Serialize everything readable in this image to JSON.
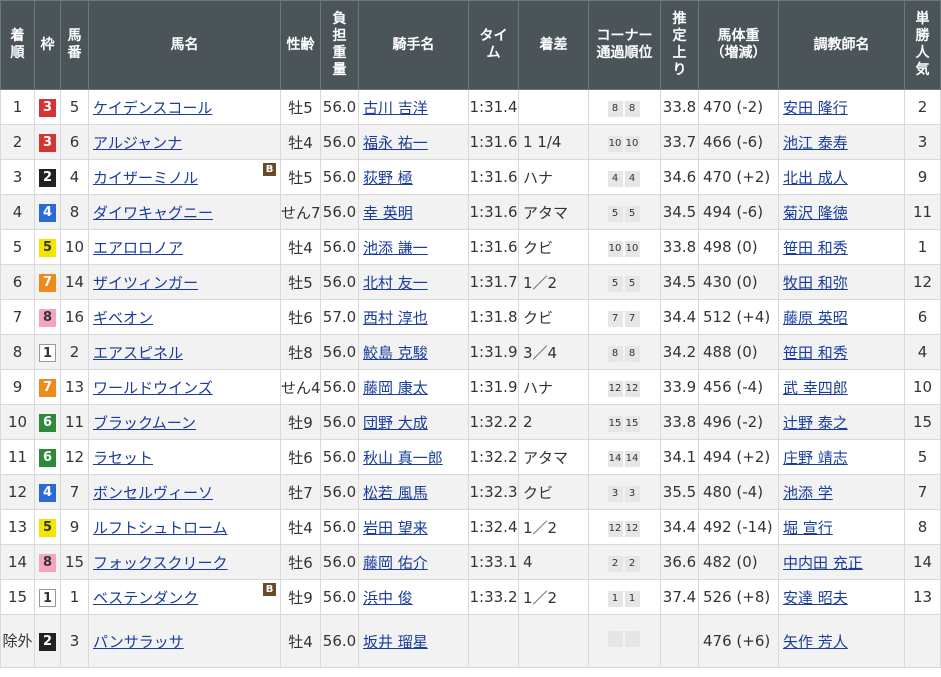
{
  "header": {
    "chakujun": [
      "着",
      "順"
    ],
    "waku": "枠",
    "umaban": [
      "馬",
      "番"
    ],
    "bamei": "馬名",
    "seirei": "性齢",
    "futan": [
      "負",
      "担",
      "重",
      "量"
    ],
    "kishu": "騎手名",
    "time": [
      "タイ",
      "ム"
    ],
    "chakusa": "着差",
    "corner": [
      "コーナー",
      "通過順位"
    ],
    "agari": [
      "推",
      "定",
      "上",
      "り"
    ],
    "bataiju": [
      "馬体重",
      "（増減）"
    ],
    "chokyoshi": "調教師名",
    "ninki": [
      "単",
      "勝",
      "人",
      "気"
    ]
  },
  "rows": [
    {
      "rank": "1",
      "waku": "3",
      "umaban": "5",
      "name": "ケイデンスコール",
      "blinker": "",
      "sexage": "牡5",
      "weight": "56.0",
      "jockey": "古川 吉洋",
      "time": "1:31.4",
      "margin": "",
      "c1": "8",
      "c2": "8",
      "agari": "33.8",
      "bw": "470 (-2)",
      "trainer": "安田 隆行",
      "pop": "2"
    },
    {
      "rank": "2",
      "waku": "3",
      "umaban": "6",
      "name": "アルジャンナ",
      "blinker": "",
      "sexage": "牡4",
      "weight": "56.0",
      "jockey": "福永 祐一",
      "time": "1:31.6",
      "margin": "1 1/4",
      "c1": "10",
      "c2": "10",
      "agari": "33.7",
      "bw": "466 (-6)",
      "trainer": "池江 泰寿",
      "pop": "3"
    },
    {
      "rank": "3",
      "waku": "2",
      "umaban": "4",
      "name": "カイザーミノル",
      "blinker": "B",
      "sexage": "牡5",
      "weight": "56.0",
      "jockey": "荻野 極",
      "time": "1:31.6",
      "margin": "ハナ",
      "c1": "4",
      "c2": "4",
      "agari": "34.6",
      "bw": "470 (+2)",
      "trainer": "北出 成人",
      "pop": "9"
    },
    {
      "rank": "4",
      "waku": "4",
      "umaban": "8",
      "name": "ダイワキャグニー",
      "blinker": "",
      "sexage": "せん7",
      "weight": "56.0",
      "jockey": "幸 英明",
      "time": "1:31.6",
      "margin": "アタマ",
      "c1": "5",
      "c2": "5",
      "agari": "34.5",
      "bw": "494 (-6)",
      "trainer": "菊沢 隆徳",
      "pop": "11"
    },
    {
      "rank": "5",
      "waku": "5",
      "umaban": "10",
      "name": "エアロロノア",
      "blinker": "",
      "sexage": "牡4",
      "weight": "56.0",
      "jockey": "池添 謙一",
      "time": "1:31.6",
      "margin": "クビ",
      "c1": "10",
      "c2": "10",
      "agari": "33.8",
      "bw": "498 (0)",
      "trainer": "笹田 和秀",
      "pop": "1"
    },
    {
      "rank": "6",
      "waku": "7",
      "umaban": "14",
      "name": "ザイツィンガー",
      "blinker": "",
      "sexage": "牡5",
      "weight": "56.0",
      "jockey": "北村 友一",
      "time": "1:31.7",
      "margin": "1／2",
      "c1": "5",
      "c2": "5",
      "agari": "34.5",
      "bw": "430 (0)",
      "trainer": "牧田 和弥",
      "pop": "12"
    },
    {
      "rank": "7",
      "waku": "8",
      "umaban": "16",
      "name": "ギベオン",
      "blinker": "",
      "sexage": "牡6",
      "weight": "57.0",
      "jockey": "西村 淳也",
      "time": "1:31.8",
      "margin": "クビ",
      "c1": "7",
      "c2": "7",
      "agari": "34.4",
      "bw": "512 (+4)",
      "trainer": "藤原 英昭",
      "pop": "6"
    },
    {
      "rank": "8",
      "waku": "1",
      "umaban": "2",
      "name": "エアスピネル",
      "blinker": "",
      "sexage": "牡8",
      "weight": "56.0",
      "jockey": "鮫島 克駿",
      "time": "1:31.9",
      "margin": "3／4",
      "c1": "8",
      "c2": "8",
      "agari": "34.2",
      "bw": "488 (0)",
      "trainer": "笹田 和秀",
      "pop": "4"
    },
    {
      "rank": "9",
      "waku": "7",
      "umaban": "13",
      "name": "ワールドウインズ",
      "blinker": "",
      "sexage": "せん4",
      "weight": "56.0",
      "jockey": "藤岡 康太",
      "time": "1:31.9",
      "margin": "ハナ",
      "c1": "12",
      "c2": "12",
      "agari": "33.9",
      "bw": "456 (-4)",
      "trainer": "武 幸四郎",
      "pop": "10"
    },
    {
      "rank": "10",
      "waku": "6",
      "umaban": "11",
      "name": "ブラックムーン",
      "blinker": "",
      "sexage": "牡9",
      "weight": "56.0",
      "jockey": "団野 大成",
      "time": "1:32.2",
      "margin": "2",
      "c1": "15",
      "c2": "15",
      "agari": "33.8",
      "bw": "496 (-2)",
      "trainer": "辻野 泰之",
      "pop": "15"
    },
    {
      "rank": "11",
      "waku": "6",
      "umaban": "12",
      "name": "ラセット",
      "blinker": "",
      "sexage": "牡6",
      "weight": "56.0",
      "jockey": "秋山 真一郎",
      "time": "1:32.2",
      "margin": "アタマ",
      "c1": "14",
      "c2": "14",
      "agari": "34.1",
      "bw": "494 (+2)",
      "trainer": "庄野 靖志",
      "pop": "5"
    },
    {
      "rank": "12",
      "waku": "4",
      "umaban": "7",
      "name": "ボンセルヴィーソ",
      "blinker": "",
      "sexage": "牡7",
      "weight": "56.0",
      "jockey": "松若 風馬",
      "time": "1:32.3",
      "margin": "クビ",
      "c1": "3",
      "c2": "3",
      "agari": "35.5",
      "bw": "480 (-4)",
      "trainer": "池添 学",
      "pop": "7"
    },
    {
      "rank": "13",
      "waku": "5",
      "umaban": "9",
      "name": "ルフトシュトローム",
      "blinker": "",
      "sexage": "牡4",
      "weight": "56.0",
      "jockey": "岩田 望来",
      "time": "1:32.4",
      "margin": "1／2",
      "c1": "12",
      "c2": "12",
      "agari": "34.4",
      "bw": "492 (-14)",
      "trainer": "堀 宣行",
      "pop": "8"
    },
    {
      "rank": "14",
      "waku": "8",
      "umaban": "15",
      "name": "フォックスクリーク",
      "blinker": "",
      "sexage": "牡6",
      "weight": "56.0",
      "jockey": "藤岡 佑介",
      "time": "1:33.1",
      "margin": "4",
      "c1": "2",
      "c2": "2",
      "agari": "36.6",
      "bw": "482 (0)",
      "trainer": "中内田 充正",
      "pop": "14"
    },
    {
      "rank": "15",
      "waku": "1",
      "umaban": "1",
      "name": "ベステンダンク",
      "blinker": "B",
      "sexage": "牡9",
      "weight": "56.0",
      "jockey": "浜中 俊",
      "time": "1:33.2",
      "margin": "1／2",
      "c1": "1",
      "c2": "1",
      "agari": "37.4",
      "bw": "526 (+8)",
      "trainer": "安達 昭夫",
      "pop": "13"
    },
    {
      "rank": "除外",
      "waku": "2",
      "umaban": "3",
      "name": "パンサラッサ",
      "blinker": "",
      "sexage": "牡4",
      "weight": "56.0",
      "jockey": "坂井 瑠星",
      "time": "",
      "margin": "",
      "c1": "",
      "c2": "",
      "agari": "",
      "bw": "476 (+6)",
      "trainer": "矢作 芳人",
      "pop": ""
    }
  ]
}
